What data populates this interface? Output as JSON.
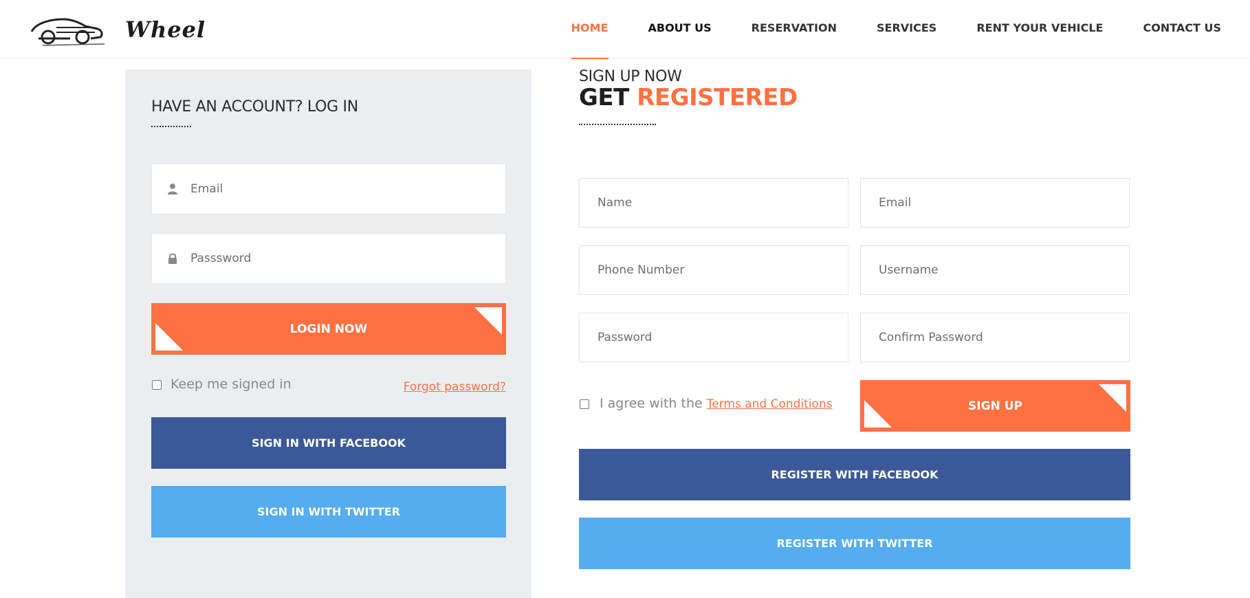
{
  "brand": {
    "name": "Wheel",
    "logo_icon": "car-logo-icon",
    "accent_color": "#ff7042"
  },
  "nav": {
    "items": [
      {
        "label": "HOME",
        "active": true
      },
      {
        "label": "ABOUT US",
        "active": false
      },
      {
        "label": "RESERVATION",
        "active": false
      },
      {
        "label": "SERVICES",
        "active": false
      },
      {
        "label": "RENT YOUR VEHICLE",
        "active": false
      },
      {
        "label": "CONTACT US",
        "active": false
      }
    ]
  },
  "login": {
    "title": "HAVE AN ACCOUNT? LOG IN",
    "email_placeholder": "Email",
    "email_icon": "user-icon",
    "password_placeholder": "Passsword",
    "password_icon": "lock-icon",
    "login_button": "LOGIN NOW",
    "keep_signed_in": "Keep me signed in",
    "forgot_password": "Forgot password?",
    "facebook_button": "SIGN IN WITH FACEBOOK",
    "twitter_button": "SIGN IN WITH TWITTER"
  },
  "register": {
    "eyebrow": "SIGN UP NOW",
    "heading_dark": "GET",
    "heading_accent": "REGISTERED",
    "fields": {
      "name": "Name",
      "email": "Email",
      "phone": "Phone Number",
      "username": "Username",
      "password": "Password",
      "confirm_password": "Confirm Password"
    },
    "agree_text": "I agree with the",
    "terms_link": "Terms and Conditions",
    "signup_button": "SIGN UP",
    "facebook_button": "REGISTER WITH FACEBOOK",
    "twitter_button": "REGISTER WITH TWITTER"
  },
  "colors": {
    "orange": "#ff7042",
    "facebook": "#3b5998",
    "twitter": "#55acee",
    "panel_bg": "#ebeef1"
  }
}
